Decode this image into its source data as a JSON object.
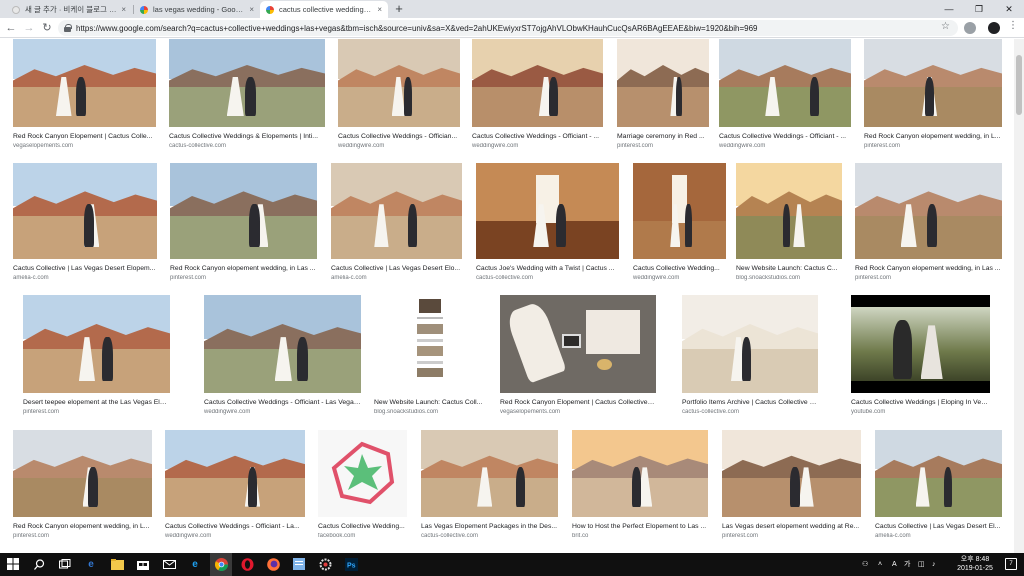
{
  "browser": {
    "tabs": [
      {
        "title": "새 글 추가 · 비케이 블로그 — 워",
        "favicon": "blog-favicon"
      },
      {
        "title": "las vegas wedding - Google 검",
        "favicon": "google-favicon"
      },
      {
        "title": "cactus collective weddings las v",
        "favicon": "google-favicon"
      }
    ],
    "new_tab_label": "+",
    "url": "https://www.google.com/search?q=cactus+collective+weddings+las+vegas&tbm=isch&source=univ&sa=X&ved=2ahUKEwiyxrST7ojgAhVLObwKHauhCucQsAR6BAgEEAE&biw=1920&bih=969",
    "window_controls": [
      "—",
      "❐",
      "✕"
    ],
    "nav": {
      "back": "←",
      "forward": "→",
      "reload": "↻"
    }
  },
  "results": [
    {
      "caption": "Red Rock Canyon Elopement | Cactus Colle...",
      "source": "vegaselopements.com"
    },
    {
      "caption": "Cactus Collective Weddings & Elopements | Inti...",
      "source": "cactus-collective.com"
    },
    {
      "caption": "Cactus Collective Weddings - Offician...",
      "source": "weddingwire.com"
    },
    {
      "caption": "Cactus Collective Weddings - Officiant - ...",
      "source": "weddingwire.com"
    },
    {
      "caption": "Marriage ceremony in Red ...",
      "source": "pinterest.com"
    },
    {
      "caption": "Cactus Collective Weddings - Officiant - ...",
      "source": "weddingwire.com"
    },
    {
      "caption": "Red Rock Canyon elopement wedding, in L...",
      "source": "pinterest.com"
    },
    {
      "caption": "Cactus Collective | Las Vegas Desert Elopem...",
      "source": "amelia-c.com"
    },
    {
      "caption": "Red Rock Canyon elopement wedding, in Las ...",
      "source": "pinterest.com"
    },
    {
      "caption": "Cactus Collective | Las Vegas Desert Elo...",
      "source": "amelia-c.com"
    },
    {
      "caption": "Cactus Joe's Wedding with a Twist | Cactus ...",
      "source": "cactus-collective.com"
    },
    {
      "caption": "Cactus Collective Wedding...",
      "source": "weddingwire.com"
    },
    {
      "caption": "New Website Launch: Cactus C...",
      "source": "blog.snoackstudios.com"
    },
    {
      "caption": "Red Rock Canyon elopement wedding, in Las ...",
      "source": "pinterest.com"
    },
    {
      "caption": "Desert teepee elopement at the Las Vegas Eldorado ...",
      "source": "pinterest.com"
    },
    {
      "caption": "Cactus Collective Weddings - Officiant - Las Vegas, ...",
      "source": "weddingwire.com"
    },
    {
      "caption": "New Website Launch: Cactus Coll...",
      "source": "blog.snoackstudios.com"
    },
    {
      "caption": "Red Rock Canyon Elopement | Cactus Collective We...",
      "source": "vegaselopements.com"
    },
    {
      "caption": "Portfolio Items Archive | Cactus Collective W...",
      "source": "cactus-collective.com"
    },
    {
      "caption": "Cactus Collective Weddings | Eloping In Vegas - Yo...",
      "source": "youtube.com"
    },
    {
      "caption": "Red Rock Canyon elopement wedding, in L...",
      "source": "pinterest.com"
    },
    {
      "caption": "Cactus Collective Weddings - Officiant - La...",
      "source": "weddingwire.com"
    },
    {
      "caption": "Cactus Collective Wedding...",
      "source": "facebook.com"
    },
    {
      "caption": "Las Vegas Elopement Packages in the Des...",
      "source": "cactus-collective.com"
    },
    {
      "caption": "How to Host the Perfect Elopement to Las ...",
      "source": "brit.co"
    },
    {
      "caption": "Las Vegas desert elopement wedding at Re...",
      "source": "pinterest.com"
    },
    {
      "caption": "Cactus Collective | Las Vegas Desert El...",
      "source": "amelia-c.com"
    }
  ],
  "taskbar": {
    "start_icon": "windows-start-icon",
    "apps": [
      "search-icon",
      "task-view-icon",
      "edge-icon",
      "file-explorer-icon",
      "store-icon",
      "mail-icon",
      "ie-icon",
      "chrome-icon",
      "opera-icon",
      "firefox-icon",
      "notes-icon",
      "settings-icon",
      "photoshop-icon"
    ],
    "tray": {
      "lang": "A",
      "ime": "가"
    },
    "clock": {
      "time": "오후 8:48",
      "date": "2019-01-25"
    },
    "notification_count": "7"
  },
  "colors": {
    "tabstrip": "#dee1e6",
    "taskbar": "#101010",
    "active_tab": "#ffffff"
  }
}
